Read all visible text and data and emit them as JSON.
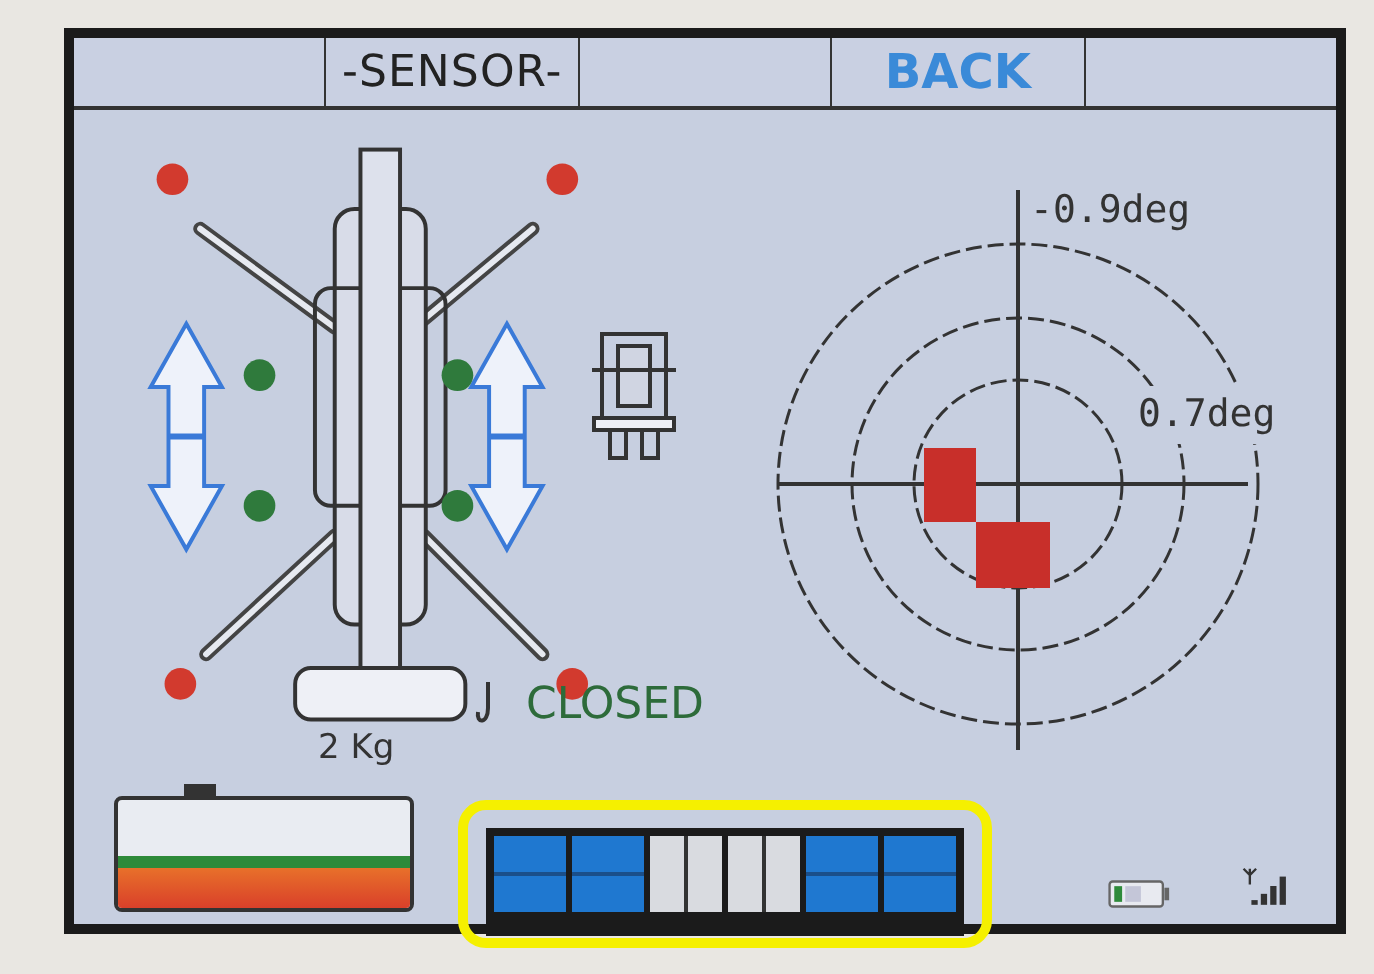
{
  "top_bar": [
    {
      "kind": "blank"
    },
    {
      "kind": "title",
      "label": "-SENSOR-"
    },
    {
      "kind": "blank"
    },
    {
      "kind": "button",
      "label": "BACK"
    },
    {
      "kind": "blank"
    }
  ],
  "outrigger_lamps": [
    {
      "color": "#d23a2e"
    },
    {
      "color": "#d23a2e"
    },
    {
      "color": "#2f7a3c"
    },
    {
      "color": "#2f7a3c"
    },
    {
      "color": "#2f7a3c"
    },
    {
      "color": "#2f7a3c"
    },
    {
      "color": "#d23a2e"
    },
    {
      "color": "#d23a2e"
    }
  ],
  "hook": {
    "status": "CLOSED",
    "load": "2 Kg"
  },
  "inclinometer": {
    "y_reading": "-0.9deg",
    "x_reading": "0.7deg"
  },
  "segments": [
    {
      "on": true
    },
    {
      "on": true
    },
    {
      "on": false
    },
    {
      "on": false
    },
    {
      "on": true
    },
    {
      "on": true
    }
  ]
}
